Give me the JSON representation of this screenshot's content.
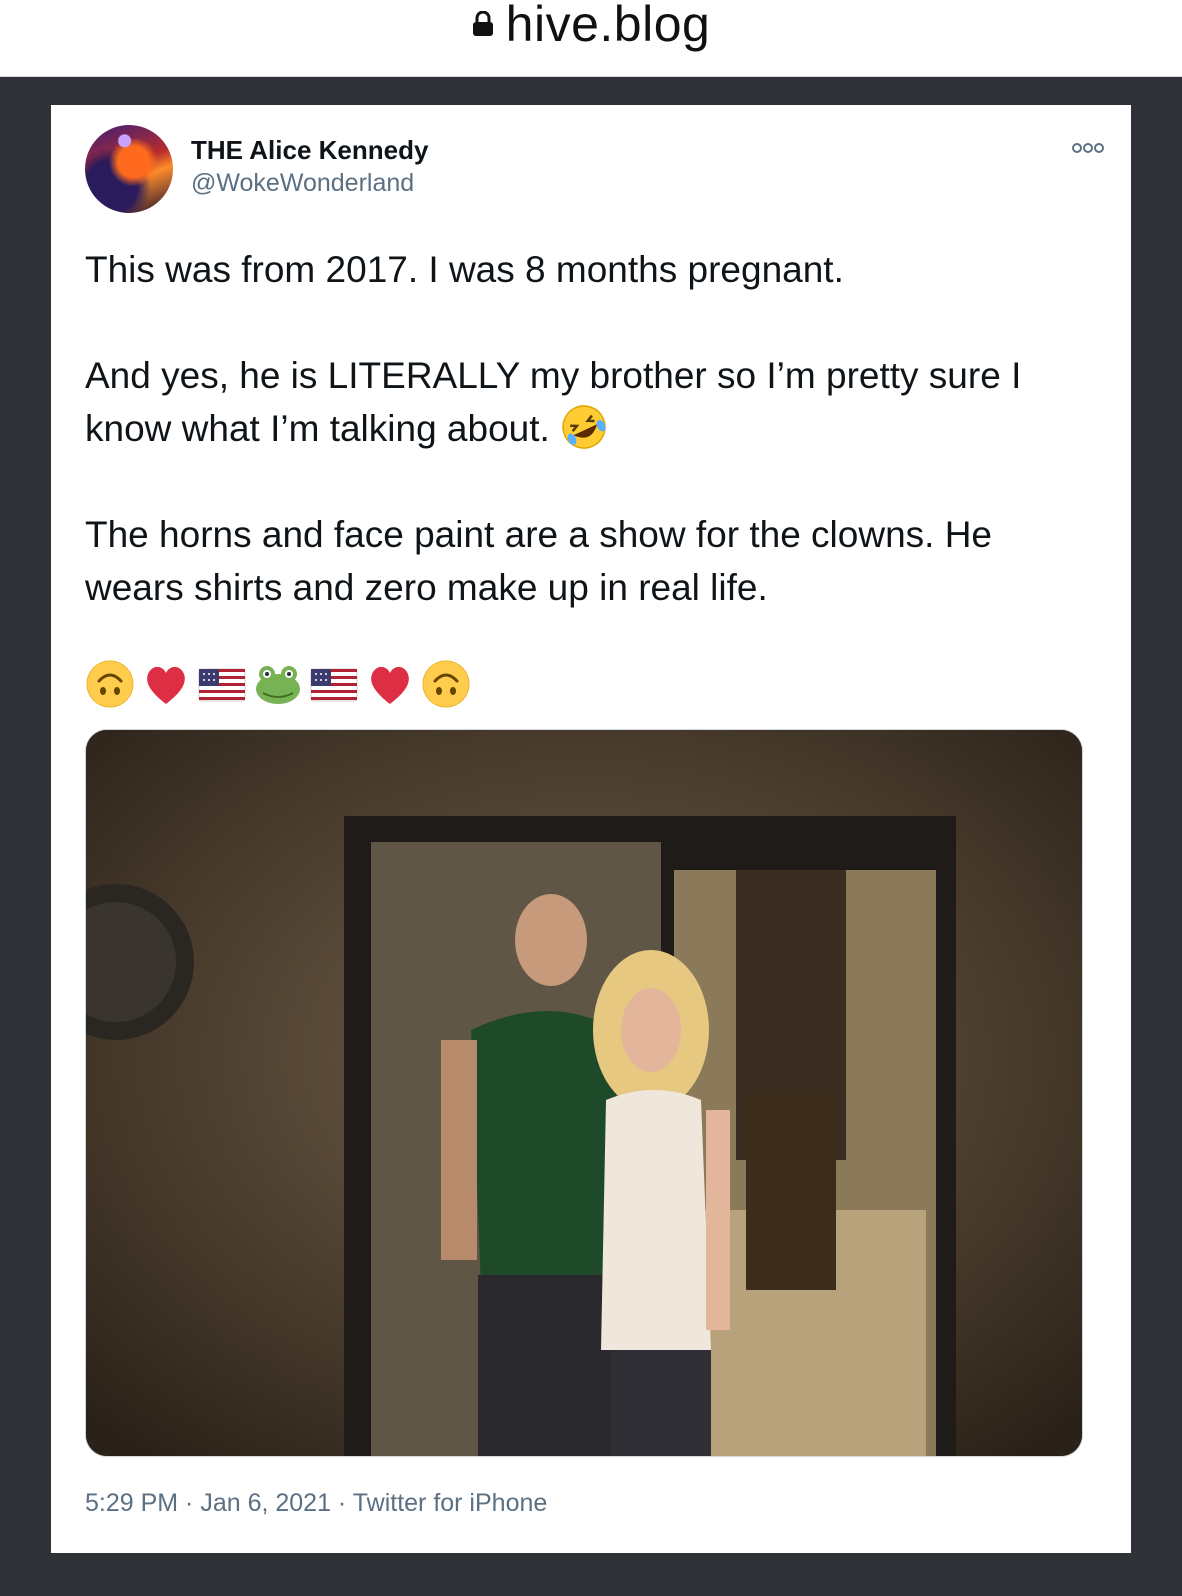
{
  "browser": {
    "url": "hive.blog",
    "lock_icon": "lock-icon"
  },
  "tweet": {
    "author_name": "THE Alice Kennedy",
    "author_handle": "@WokeWonderland",
    "more_icon": "ellipsis-icon",
    "paragraph_1": "This was from 2017. I was 8 months pregnant.",
    "paragraph_2": "And yes, he is LITERALLY my brother so I’m pretty sure I know what I’m talking about.",
    "paragraph_3": "The horns and face paint are a show for the clowns. He wears shirts and zero make up in real life.",
    "inline_emoji": "rolling-on-floor-laughing-emoji",
    "emoji_row": [
      "upside-down-face-emoji",
      "red-heart-emoji",
      "us-flag-emoji",
      "frog-face-emoji",
      "us-flag-emoji",
      "red-heart-emoji",
      "upside-down-face-emoji"
    ],
    "photo_icon": "photo-of-two-people-image",
    "timestamp": "5:29 PM · Jan 6, 2021 · Twitter for iPhone"
  },
  "colors": {
    "background": "#2f3337",
    "card": "#ffffff",
    "text": "#0f1419",
    "secondary_text": "#5b7083"
  }
}
